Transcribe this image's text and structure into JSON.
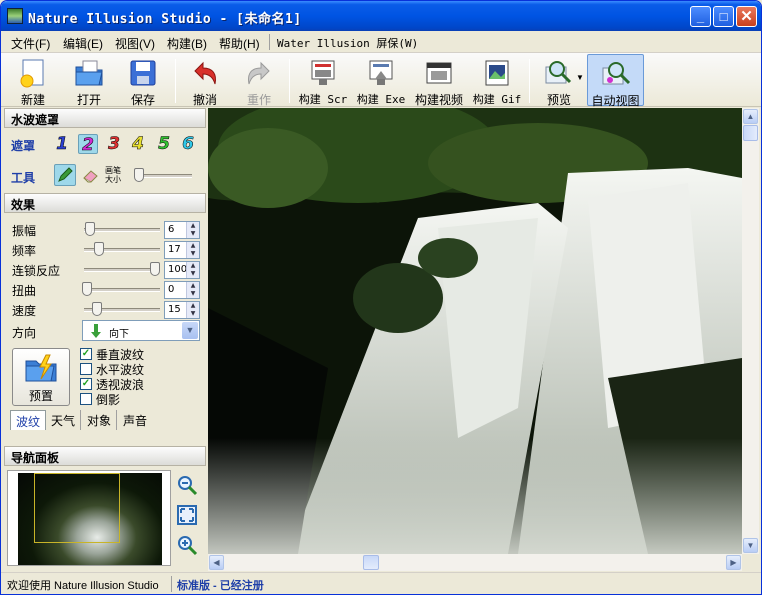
{
  "window": {
    "title": "Nature Illusion Studio - [未命名1]",
    "minimize": "_",
    "maximize": "□",
    "close": "✕"
  },
  "menu": {
    "items": [
      "文件(F)",
      "编辑(E)",
      "视图(V)",
      "构建(B)",
      "帮助(H)"
    ],
    "extra": "Water Illusion 屏保(W)"
  },
  "toolbar": {
    "new": "新建",
    "open": "打开",
    "save": "保存",
    "undo": "撤消",
    "redo": "重作",
    "build_scr": "构建 Scr",
    "build_exe": "构建 Exe",
    "build_video": "构建视频",
    "build_gif": "构建 Gif",
    "preview": "预览",
    "auto_view": "自动视图"
  },
  "left": {
    "mask_section": "水波遮罩",
    "mask_label": "遮罩",
    "mask_numbers": [
      "1",
      "2",
      "3",
      "4",
      "5",
      "6"
    ],
    "mask_colors": [
      "#2a3fd0",
      "#d02ad0",
      "#e03030",
      "#e8e030",
      "#30c030",
      "#30c8e8"
    ],
    "tool_label": "工具",
    "brush_label_1": "画笔",
    "brush_label_2": "大小",
    "effects_section": "效果",
    "params": [
      {
        "label": "振幅",
        "value": "6",
        "level": 0.05
      },
      {
        "label": "频率",
        "value": "17",
        "level": 0.17
      },
      {
        "label": "连锁反应",
        "value": "100",
        "level": 1.0
      },
      {
        "label": "扭曲",
        "value": "0",
        "level": 0.0
      },
      {
        "label": "速度",
        "value": "15",
        "level": 0.15
      }
    ],
    "direction_label": "方向",
    "direction_value": "向下",
    "preset_label": "预置",
    "checkboxes": [
      {
        "label": "垂直波纹",
        "checked": true
      },
      {
        "label": "水平波纹",
        "checked": false
      },
      {
        "label": "透视波浪",
        "checked": true
      },
      {
        "label": "倒影",
        "checked": false
      }
    ],
    "tabs": [
      "波纹",
      "天气",
      "对象",
      "声音"
    ],
    "nav_section": "导航面板"
  },
  "status": {
    "left": "欢迎使用 Nature Illusion Studio",
    "right": "标准版 - 已经注册"
  }
}
